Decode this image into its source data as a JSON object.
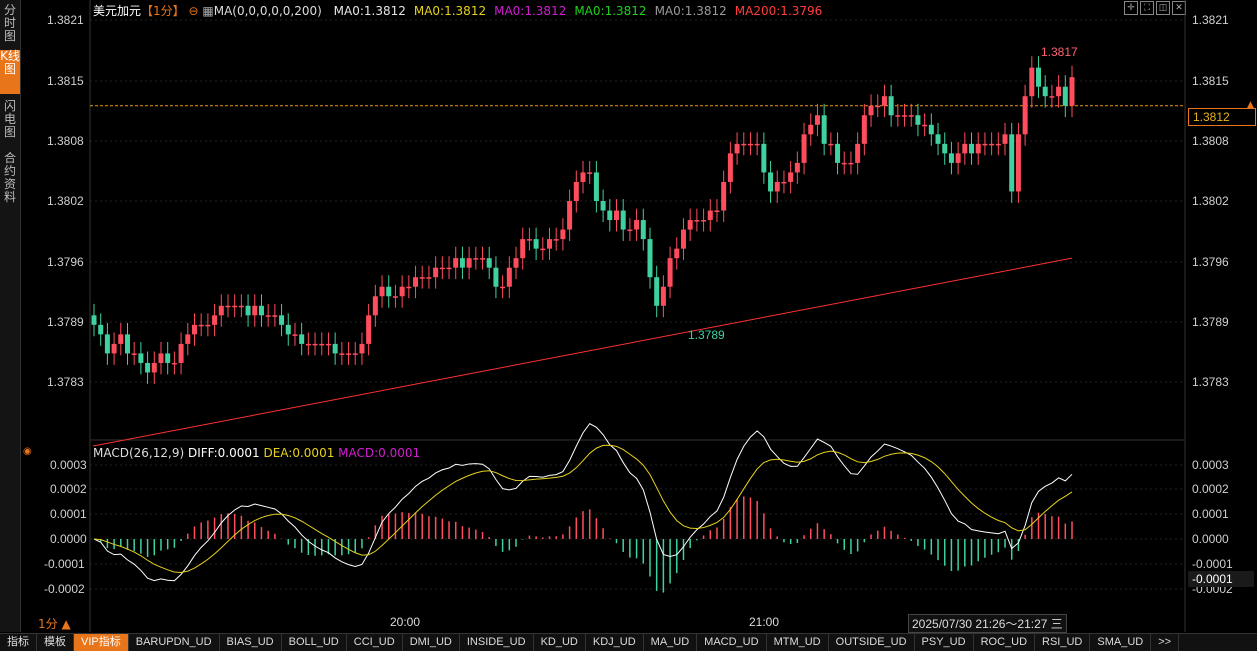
{
  "side_tabs": [
    "分时图",
    "K线图",
    "闪电图",
    "合约资料"
  ],
  "legend": {
    "symbol": "美元加元",
    "period": "【1分】",
    "ma_setting": "MA(0,0,0,0,0,200)",
    "ma_values": [
      {
        "text": "MA0:1.3812",
        "color": "#e6e6e6"
      },
      {
        "text": "MA0:1.3812",
        "color": "#e6d21e"
      },
      {
        "text": "MA0:1.3812",
        "color": "#d21ed2"
      },
      {
        "text": "MA0:1.3812",
        "color": "#1ed21e"
      },
      {
        "text": "MA0:1.3812",
        "color": "#9a9a9a"
      },
      {
        "text": "MA200:1.3796",
        "color": "#ff3c3c"
      }
    ]
  },
  "price_axis_labels": [
    "1.3821",
    "1.3815",
    "1.3808",
    "1.3802",
    "1.3796",
    "1.3789",
    "1.3783"
  ],
  "current_price": "1.3812",
  "high_marker": "1.3817",
  "low_marker": "1.3789",
  "macd_legend": {
    "title": "MACD(26,12,9)",
    "diff": "DIFF:0.0001",
    "dea": "DEA:0.0001",
    "macd": "MACD:0.0001"
  },
  "macd_axis_labels": [
    "0.0003",
    "0.0002",
    "0.0001",
    "0.0000",
    "-0.0001",
    "-0.0002"
  ],
  "macd_current": "-0.0001",
  "time_labels": [
    "20:00",
    "21:00"
  ],
  "period_selector": "1分 ▲",
  "time_range": "2025/07/30 21:26～21:27",
  "menu_icon": "三",
  "bottom_tabs": [
    "指标",
    "模板",
    "VIP指标",
    "BARUPDN_UD",
    "BIAS_UD",
    "BOLL_UD",
    "CCI_UD",
    "DMI_UD",
    "INSIDE_UD",
    "KD_UD",
    "KDJ_UD",
    "MA_UD",
    "MACD_UD",
    "MTM_UD",
    "OUTSIDE_UD",
    "PSY_UD",
    "ROC_UD",
    "RSI_UD",
    "SMA_UD",
    ">>"
  ],
  "colors": {
    "up": "#ff4d5e",
    "down": "#3fd1a0",
    "ma200": "#ff3030",
    "diff": "#ffffff",
    "dea": "#e6d21e",
    "dashed": "#e89a1a"
  },
  "chart_data": {
    "type": "candlestick",
    "ylim": [
      1.3779,
      1.3823
    ],
    "closes": [
      1.3789,
      1.3788,
      1.3786,
      1.3787,
      1.3788,
      1.3786,
      1.3786,
      1.3785,
      1.3784,
      1.3785,
      1.3786,
      1.3785,
      1.3785,
      1.3787,
      1.3788,
      1.3789,
      1.3789,
      1.3789,
      1.379,
      1.3791,
      1.3791,
      1.3791,
      1.3791,
      1.379,
      1.3791,
      1.379,
      1.379,
      1.379,
      1.3789,
      1.3788,
      1.3788,
      1.3787,
      1.3787,
      1.3787,
      1.3787,
      1.3787,
      1.3786,
      1.3786,
      1.3786,
      1.3786,
      1.3787,
      1.379,
      1.3792,
      1.3793,
      1.3792,
      1.3792,
      1.3793,
      1.3793,
      1.3794,
      1.3794,
      1.3794,
      1.3795,
      1.3795,
      1.3795,
      1.3796,
      1.3795,
      1.3796,
      1.3796,
      1.3796,
      1.3795,
      1.3793,
      1.3793,
      1.3795,
      1.3796,
      1.3798,
      1.3798,
      1.3797,
      1.3797,
      1.3798,
      1.3798,
      1.3799,
      1.3802,
      1.3804,
      1.3805,
      1.3805,
      1.3802,
      1.3801,
      1.38,
      1.3801,
      1.3799,
      1.3799,
      1.38,
      1.3798,
      1.3794,
      1.3791,
      1.3793,
      1.3796,
      1.3797,
      1.3799,
      1.38,
      1.38,
      1.38,
      1.3801,
      1.3801,
      1.3804,
      1.3807,
      1.3808,
      1.3808,
      1.3808,
      1.3808,
      1.3805,
      1.3803,
      1.3804,
      1.3804,
      1.3805,
      1.3806,
      1.3809,
      1.381,
      1.3811,
      1.3808,
      1.3808,
      1.3806,
      1.3806,
      1.3806,
      1.3808,
      1.3811,
      1.3812,
      1.3812,
      1.3813,
      1.3811,
      1.3811,
      1.3811,
      1.3811,
      1.381,
      1.381,
      1.3809,
      1.3808,
      1.3807,
      1.3806,
      1.3807,
      1.3808,
      1.3807,
      1.3808,
      1.3808,
      1.3808,
      1.3808,
      1.3809,
      1.3803,
      1.3809,
      1.3813,
      1.3816,
      1.3814,
      1.3813,
      1.3813,
      1.3814,
      1.3812,
      1.3815
    ],
    "ma200": {
      "start": 1.3781,
      "end": 1.3796
    },
    "high": 1.3817,
    "low": 1.3789
  }
}
